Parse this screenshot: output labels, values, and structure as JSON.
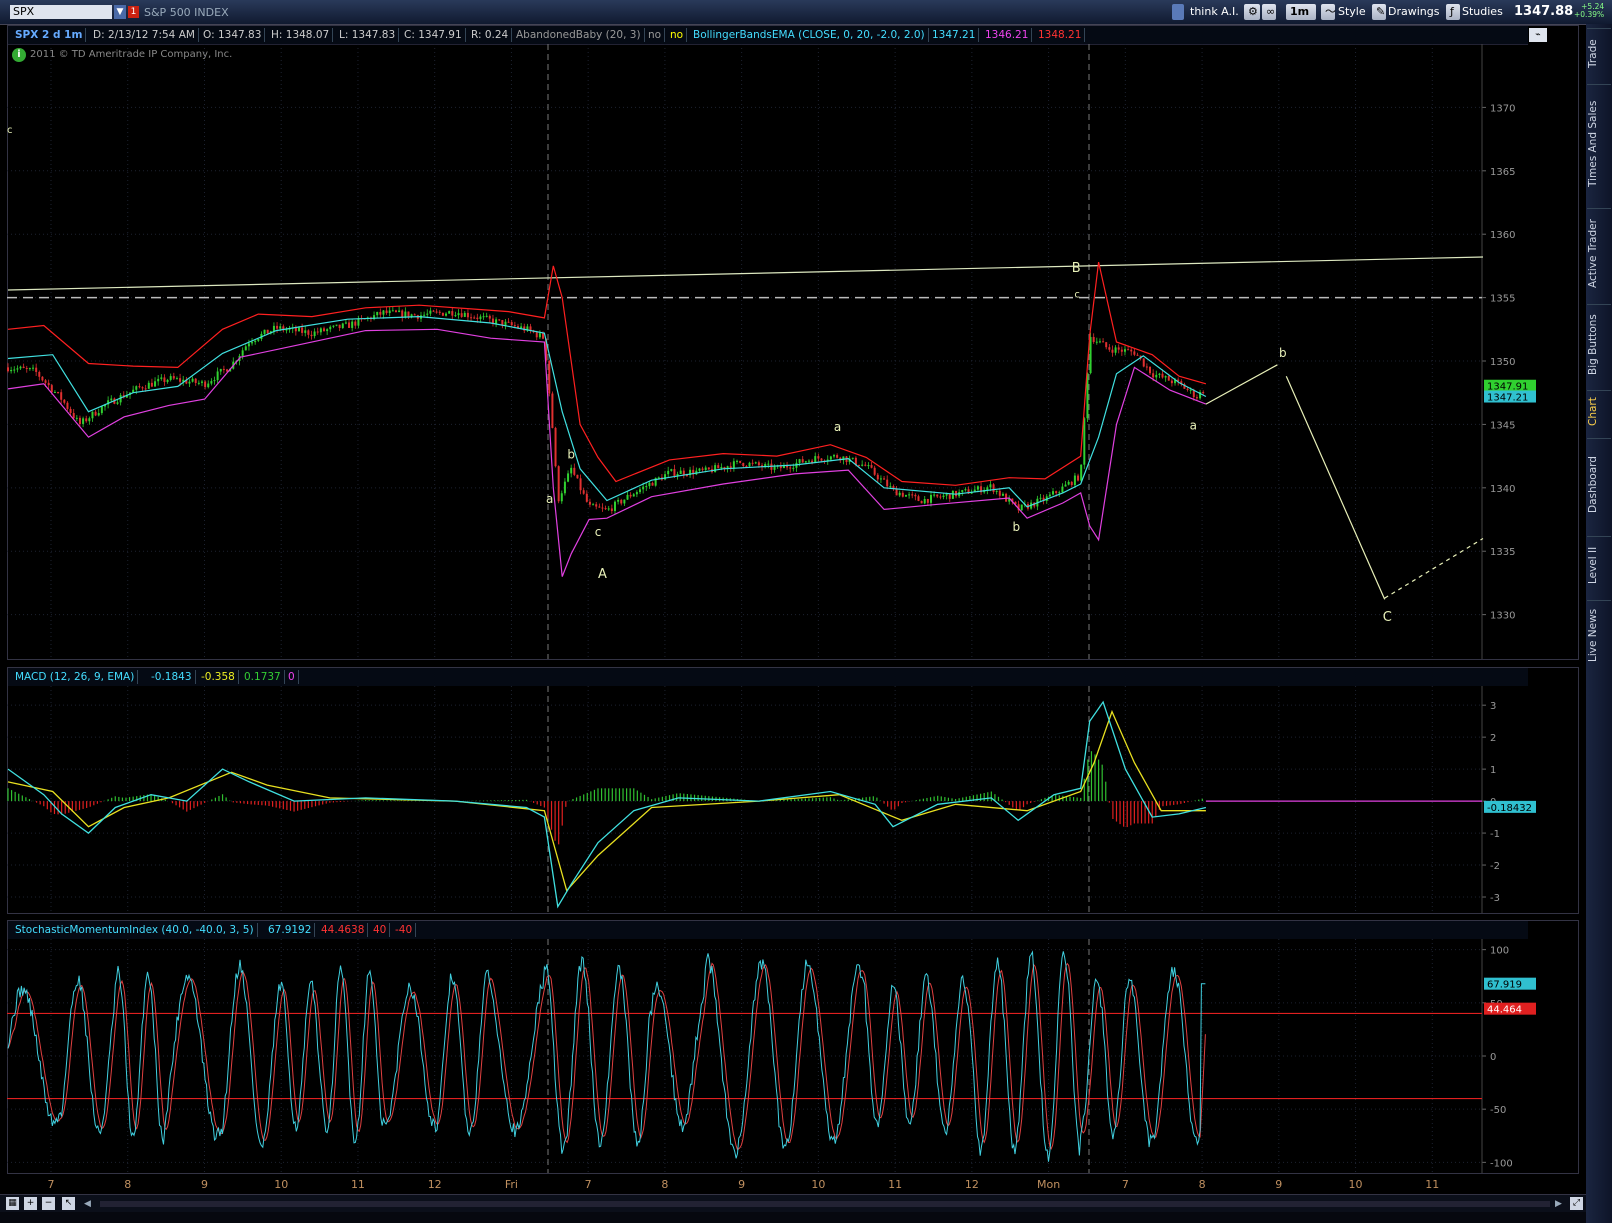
{
  "toolbar": {
    "symbol": "SPX",
    "alert_badge": "1",
    "description": "S&P 500 INDEX",
    "think_ai": "think A.I.",
    "timeframe": "1m",
    "style": "Style",
    "drawings": "Drawings",
    "studies": "Studies",
    "last_price": "1347.88",
    "change_points": "+5.24",
    "change_pct": "+0.39%"
  },
  "header": {
    "chart_label": "SPX 2 d 1m",
    "date": "D: 2/13/12 7:54 AM",
    "open": "O: 1347.83",
    "high": "H: 1348.07",
    "low": "L: 1347.83",
    "close": "C: 1347.91",
    "range": "R: 0.24",
    "pattern": "AbandonedBaby (20, 3)",
    "pattern_val1": "no",
    "pattern_val2": "no",
    "bb_label": "BollingerBandsEMA (CLOSE, 0, 20, -2.0, 2.0)",
    "bb_mid": "1347.21",
    "bb_lower": "1346.21",
    "bb_upper": "1348.21",
    "copyright": "2011 © TD Ameritrade IP Company, Inc."
  },
  "sidebar": {
    "tabs": [
      "Trade",
      "Times And Sales",
      "Active Trader",
      "Big Buttons",
      "Chart",
      "Dashboard",
      "Level II",
      "Live News"
    ],
    "active": "Chart"
  },
  "colors": {
    "bg": "#000000",
    "bb_upper": "#ff2020",
    "bb_lower": "#e040e0",
    "bb_mid": "#40e0e0",
    "macd": "#40e0e0",
    "signal": "#e8e020",
    "hist_pos": "#30c030",
    "hist_neg": "#e02020",
    "smi": "#40d0e0",
    "smi_avg": "#e04040",
    "candle_up": "#30d030",
    "candle_down": "#e03030",
    "annot": "#e8f0b8"
  },
  "chart_data": [
    {
      "type": "line",
      "name_label": "price",
      "y_ticks": [
        1370,
        1365,
        1360,
        1355,
        1350,
        1345,
        1340,
        1335,
        1330
      ],
      "ylim": [
        1326.5,
        1375
      ],
      "last_close_tag": "1347.91",
      "last_mid_tag": "1347.21",
      "x_labels": [
        "7",
        "8",
        "9",
        "10",
        "11",
        "12",
        "Fri",
        "7",
        "8",
        "9",
        "10",
        "11",
        "12",
        "Mon",
        "7",
        "8",
        "9",
        "10",
        "11"
      ],
      "wave_labels": [
        "c",
        "b",
        "a",
        "c",
        "A",
        "a",
        "b",
        "B",
        "c",
        "b",
        "a",
        "C"
      ],
      "price": [
        {
          "t": 0,
          "v": 1349.5
        },
        {
          "t": 3,
          "v": 1349.2
        },
        {
          "t": 6,
          "v": 1347
        },
        {
          "t": 8,
          "v": 1345
        },
        {
          "t": 11,
          "v": 1346.6
        },
        {
          "t": 15,
          "v": 1348
        },
        {
          "t": 18,
          "v": 1348.6
        },
        {
          "t": 22,
          "v": 1348.2
        },
        {
          "t": 25,
          "v": 1349.7
        },
        {
          "t": 27,
          "v": 1351.6
        },
        {
          "t": 30,
          "v": 1352.6
        },
        {
          "t": 34,
          "v": 1352.2
        },
        {
          "t": 38,
          "v": 1352.8
        },
        {
          "t": 42,
          "v": 1353.8
        },
        {
          "t": 46,
          "v": 1353.6
        },
        {
          "t": 50,
          "v": 1353.9
        },
        {
          "t": 54,
          "v": 1353.2
        },
        {
          "t": 58,
          "v": 1352.5
        },
        {
          "t": 60,
          "v": 1351.8
        },
        {
          "t": 61,
          "v": 1344
        },
        {
          "t": 61.5,
          "v": 1339
        },
        {
          "t": 63,
          "v": 1341.5
        },
        {
          "t": 65,
          "v": 1338.5
        },
        {
          "t": 67,
          "v": 1338.2
        },
        {
          "t": 70,
          "v": 1339.6
        },
        {
          "t": 74,
          "v": 1341.2
        },
        {
          "t": 78,
          "v": 1341.3
        },
        {
          "t": 82,
          "v": 1342
        },
        {
          "t": 86,
          "v": 1341.5
        },
        {
          "t": 90,
          "v": 1342.3
        },
        {
          "t": 93,
          "v": 1342.5
        },
        {
          "t": 96,
          "v": 1341.7
        },
        {
          "t": 99,
          "v": 1339.8
        },
        {
          "t": 102,
          "v": 1339
        },
        {
          "t": 106,
          "v": 1339.5
        },
        {
          "t": 110,
          "v": 1340.1
        },
        {
          "t": 113,
          "v": 1338.3
        },
        {
          "t": 116,
          "v": 1339.1
        },
        {
          "t": 118,
          "v": 1340
        },
        {
          "t": 120,
          "v": 1341
        },
        {
          "t": 121,
          "v": 1352
        },
        {
          "t": 123,
          "v": 1351
        },
        {
          "t": 126,
          "v": 1350.7
        },
        {
          "t": 128,
          "v": 1349
        },
        {
          "t": 131,
          "v": 1348.2
        },
        {
          "t": 133,
          "v": 1347.2
        },
        {
          "t": 134,
          "v": 1347.9
        }
      ],
      "bb_upper": [
        {
          "t": 0,
          "v": 1352.5
        },
        {
          "t": 4,
          "v": 1352.8
        },
        {
          "t": 9,
          "v": 1349.8
        },
        {
          "t": 14,
          "v": 1349.6
        },
        {
          "t": 19,
          "v": 1349.5
        },
        {
          "t": 24,
          "v": 1352.5
        },
        {
          "t": 28,
          "v": 1353.7
        },
        {
          "t": 34,
          "v": 1353.5
        },
        {
          "t": 40,
          "v": 1354.2
        },
        {
          "t": 46,
          "v": 1354.4
        },
        {
          "t": 52,
          "v": 1354.1
        },
        {
          "t": 56,
          "v": 1353.9
        },
        {
          "t": 60,
          "v": 1353.4
        },
        {
          "t": 61,
          "v": 1357.5
        },
        {
          "t": 62,
          "v": 1355
        },
        {
          "t": 64,
          "v": 1345
        },
        {
          "t": 66,
          "v": 1342.4
        },
        {
          "t": 68,
          "v": 1340.5
        },
        {
          "t": 74,
          "v": 1342.2
        },
        {
          "t": 80,
          "v": 1342.7
        },
        {
          "t": 86,
          "v": 1342.5
        },
        {
          "t": 92,
          "v": 1343.4
        },
        {
          "t": 96,
          "v": 1342.4
        },
        {
          "t": 100,
          "v": 1340.5
        },
        {
          "t": 106,
          "v": 1340.2
        },
        {
          "t": 112,
          "v": 1340.8
        },
        {
          "t": 116,
          "v": 1340.7
        },
        {
          "t": 120,
          "v": 1342.5
        },
        {
          "t": 121,
          "v": 1352
        },
        {
          "t": 122,
          "v": 1357.8
        },
        {
          "t": 124,
          "v": 1351.5
        },
        {
          "t": 128,
          "v": 1350.5
        },
        {
          "t": 131,
          "v": 1348.8
        },
        {
          "t": 134,
          "v": 1348.2
        }
      ],
      "bb_lower": [
        {
          "t": 0,
          "v": 1347.8
        },
        {
          "t": 4,
          "v": 1348.2
        },
        {
          "t": 9,
          "v": 1344
        },
        {
          "t": 13,
          "v": 1345.6
        },
        {
          "t": 18,
          "v": 1346.5
        },
        {
          "t": 22,
          "v": 1347
        },
        {
          "t": 26,
          "v": 1350.3
        },
        {
          "t": 32,
          "v": 1351.2
        },
        {
          "t": 40,
          "v": 1352.4
        },
        {
          "t": 48,
          "v": 1352.5
        },
        {
          "t": 54,
          "v": 1351.8
        },
        {
          "t": 60,
          "v": 1351.5
        },
        {
          "t": 61,
          "v": 1340
        },
        {
          "t": 62,
          "v": 1333
        },
        {
          "t": 63,
          "v": 1334.8
        },
        {
          "t": 65,
          "v": 1337.5
        },
        {
          "t": 67,
          "v": 1337.6
        },
        {
          "t": 72,
          "v": 1339.3
        },
        {
          "t": 80,
          "v": 1340.3
        },
        {
          "t": 88,
          "v": 1341.1
        },
        {
          "t": 94,
          "v": 1341.4
        },
        {
          "t": 98,
          "v": 1338.3
        },
        {
          "t": 104,
          "v": 1338.7
        },
        {
          "t": 112,
          "v": 1339.2
        },
        {
          "t": 114,
          "v": 1337.6
        },
        {
          "t": 118,
          "v": 1338.8
        },
        {
          "t": 120,
          "v": 1339.6
        },
        {
          "t": 121,
          "v": 1337
        },
        {
          "t": 122,
          "v": 1335.9
        },
        {
          "t": 124,
          "v": 1345
        },
        {
          "t": 126,
          "v": 1349.5
        },
        {
          "t": 130,
          "v": 1347.7
        },
        {
          "t": 134,
          "v": 1346.6
        }
      ],
      "bb_mid": [
        {
          "t": 0,
          "v": 1350.2
        },
        {
          "t": 5,
          "v": 1350.5
        },
        {
          "t": 9,
          "v": 1346
        },
        {
          "t": 14,
          "v": 1347.5
        },
        {
          "t": 19,
          "v": 1348
        },
        {
          "t": 24,
          "v": 1350.6
        },
        {
          "t": 30,
          "v": 1352.4
        },
        {
          "t": 38,
          "v": 1353.3
        },
        {
          "t": 46,
          "v": 1353.5
        },
        {
          "t": 54,
          "v": 1353
        },
        {
          "t": 60,
          "v": 1352.2
        },
        {
          "t": 62,
          "v": 1346
        },
        {
          "t": 64,
          "v": 1341.5
        },
        {
          "t": 67,
          "v": 1339
        },
        {
          "t": 72,
          "v": 1340.6
        },
        {
          "t": 80,
          "v": 1341.5
        },
        {
          "t": 88,
          "v": 1341.8
        },
        {
          "t": 94,
          "v": 1342.3
        },
        {
          "t": 98,
          "v": 1340
        },
        {
          "t": 106,
          "v": 1339.5
        },
        {
          "t": 112,
          "v": 1340
        },
        {
          "t": 114,
          "v": 1338.5
        },
        {
          "t": 118,
          "v": 1339.6
        },
        {
          "t": 120,
          "v": 1340.3
        },
        {
          "t": 122,
          "v": 1344
        },
        {
          "t": 124,
          "v": 1349
        },
        {
          "t": 127,
          "v": 1350.4
        },
        {
          "t": 131,
          "v": 1348.3
        },
        {
          "t": 134,
          "v": 1347.2
        }
      ],
      "trendline": [
        {
          "t": 0,
          "v": 1355.6
        },
        {
          "t": 165,
          "v": 1358.2
        }
      ],
      "dashed_level": 1355,
      "projection": [
        {
          "t": 134,
          "v": 1346.6
        },
        {
          "t": 142,
          "v": 1349.7
        }
      ],
      "projection2": [
        {
          "t": 143,
          "v": 1348.8
        },
        {
          "t": 154,
          "v": 1331.2
        }
      ],
      "projection3_dashed": [
        {
          "t": 154,
          "v": 1331.3
        },
        {
          "t": 165,
          "v": 1336
        }
      ]
    },
    {
      "type": "line",
      "name_label": "macd",
      "title": "MACD (12, 26, 9, EMA)",
      "values_text": [
        "-0.1843",
        "-0.358",
        "0.1737",
        "0"
      ],
      "y_ticks": [
        3,
        2,
        1,
        0,
        -1,
        -2,
        -3
      ],
      "ylim": [
        -3.5,
        3.6
      ],
      "last_tag": "-0.18432",
      "macd": [
        {
          "t": 0,
          "v": 1
        },
        {
          "t": 4,
          "v": 0.2
        },
        {
          "t": 6,
          "v": -0.4
        },
        {
          "t": 9,
          "v": -1
        },
        {
          "t": 12,
          "v": -0.2
        },
        {
          "t": 16,
          "v": 0.2
        },
        {
          "t": 20,
          "v": 0
        },
        {
          "t": 24,
          "v": 1
        },
        {
          "t": 27,
          "v": 0.6
        },
        {
          "t": 32,
          "v": 0
        },
        {
          "t": 40,
          "v": 0.1
        },
        {
          "t": 50,
          "v": 0
        },
        {
          "t": 58,
          "v": -0.2
        },
        {
          "t": 60,
          "v": -0.5
        },
        {
          "t": 61.5,
          "v": -3.3
        },
        {
          "t": 63,
          "v": -2.6
        },
        {
          "t": 66,
          "v": -1.3
        },
        {
          "t": 70,
          "v": -0.3
        },
        {
          "t": 75,
          "v": 0.1
        },
        {
          "t": 84,
          "v": 0
        },
        {
          "t": 92,
          "v": 0.3
        },
        {
          "t": 97,
          "v": -0.1
        },
        {
          "t": 99,
          "v": -0.8
        },
        {
          "t": 104,
          "v": -0.1
        },
        {
          "t": 110,
          "v": 0.1
        },
        {
          "t": 113,
          "v": -0.6
        },
        {
          "t": 117,
          "v": 0.2
        },
        {
          "t": 120,
          "v": 0.4
        },
        {
          "t": 121,
          "v": 2.5
        },
        {
          "t": 122.5,
          "v": 3.1
        },
        {
          "t": 125,
          "v": 1
        },
        {
          "t": 128,
          "v": -0.5
        },
        {
          "t": 131,
          "v": -0.4
        },
        {
          "t": 134,
          "v": -0.2
        }
      ],
      "signal": [
        {
          "t": 0,
          "v": 0.6
        },
        {
          "t": 5,
          "v": 0.3
        },
        {
          "t": 9,
          "v": -0.8
        },
        {
          "t": 13,
          "v": -0.2
        },
        {
          "t": 18,
          "v": 0.1
        },
        {
          "t": 25,
          "v": 0.9
        },
        {
          "t": 29,
          "v": 0.5
        },
        {
          "t": 36,
          "v": 0.1
        },
        {
          "t": 50,
          "v": 0
        },
        {
          "t": 60,
          "v": -0.3
        },
        {
          "t": 62.5,
          "v": -2.8
        },
        {
          "t": 66,
          "v": -1.7
        },
        {
          "t": 72,
          "v": -0.2
        },
        {
          "t": 84,
          "v": 0
        },
        {
          "t": 93,
          "v": 0.2
        },
        {
          "t": 100,
          "v": -0.6
        },
        {
          "t": 106,
          "v": -0.1
        },
        {
          "t": 114,
          "v": -0.3
        },
        {
          "t": 120,
          "v": 0.3
        },
        {
          "t": 121.5,
          "v": 1.2
        },
        {
          "t": 123.5,
          "v": 2.8
        },
        {
          "t": 126,
          "v": 1.2
        },
        {
          "t": 129,
          "v": -0.3
        },
        {
          "t": 134,
          "v": -0.3
        }
      ]
    },
    {
      "type": "line",
      "name_label": "smi",
      "title": "StochasticMomentumIndex (40.0, -40.0, 3, 5)",
      "values_text": [
        "67.9192",
        "44.4638",
        "40",
        "-40"
      ],
      "y_ticks": [
        100,
        50,
        0,
        -50,
        -100
      ],
      "ylim": [
        -110,
        110
      ],
      "upper_band": 40,
      "lower_band": -40,
      "last_smi_tag": "67.919",
      "last_avg_tag": "44.464"
    }
  ]
}
